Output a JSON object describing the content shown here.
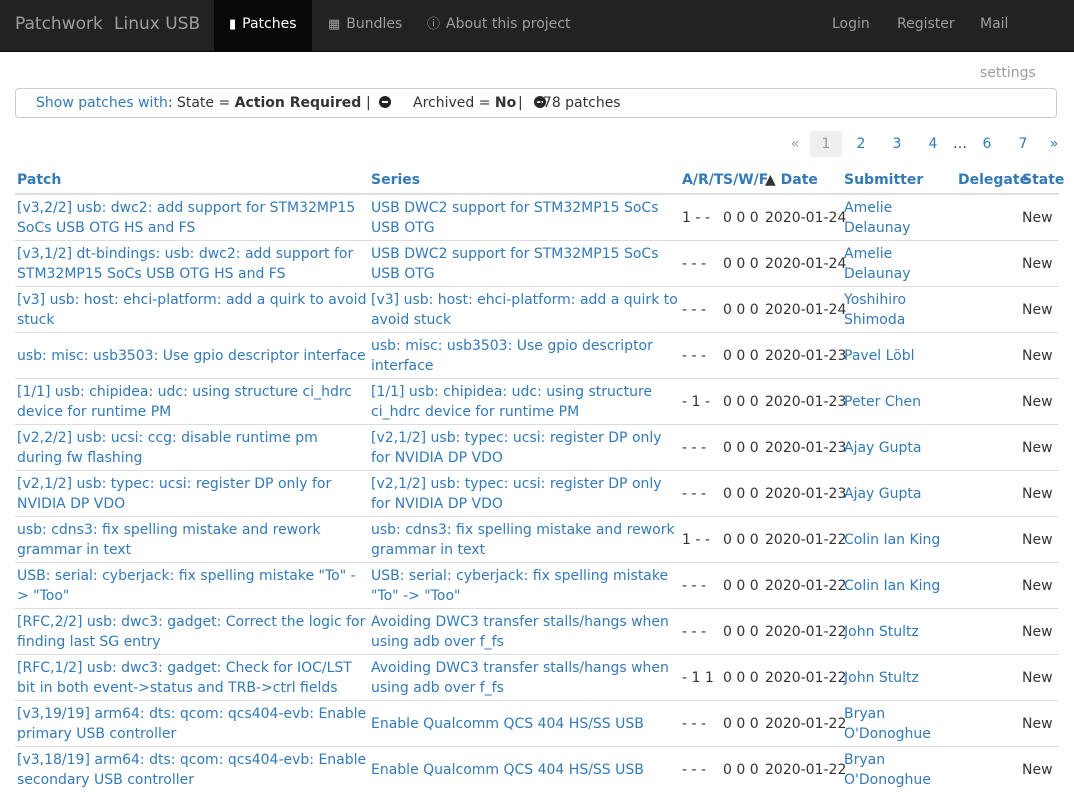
{
  "nav": {
    "brand": "Patchwork",
    "project": "Linux USB",
    "patches": "Patches",
    "bundles": "Bundles",
    "about": "About this project",
    "login": "Login",
    "register": "Register",
    "mail": "Mail settings"
  },
  "filter": {
    "show": "Show patches with",
    "state_label": ": State = ",
    "state_value": "Action Required",
    "sep1": "|",
    "archived_label": "Archived = ",
    "archived_value": "No",
    "sep2": "|",
    "count": "678 patches"
  },
  "pagination": {
    "prev": "«",
    "pages": [
      "1",
      "2",
      "3",
      "4"
    ],
    "ellipsis": "…",
    "pages2": [
      "6",
      "7"
    ],
    "next": "»"
  },
  "table": {
    "headers": {
      "patch": "Patch",
      "series": "Series",
      "art": "A/R/T",
      "swf": "S/W/F",
      "date": "Date",
      "submitter": "Submitter",
      "delegate": "Delegate",
      "state": "State"
    },
    "rows": [
      {
        "patch": "[v3,2/2] usb: dwc2: add support for STM32MP15 SoCs USB OTG HS and FS",
        "series": "USB DWC2 support for STM32MP15 SoCs USB OTG",
        "art": "1 - -",
        "swf": "0 0 0",
        "date": "2020-01-24",
        "submitter": "Amelie Delaunay",
        "delegate": "",
        "state": "New"
      },
      {
        "patch": "[v3,1/2] dt-bindings: usb: dwc2: add support for STM32MP15 SoCs USB OTG HS and FS",
        "series": "USB DWC2 support for STM32MP15 SoCs USB OTG",
        "art": "- - -",
        "swf": "0 0 0",
        "date": "2020-01-24",
        "submitter": "Amelie Delaunay",
        "delegate": "",
        "state": "New"
      },
      {
        "patch": "[v3] usb: host: ehci-platform: add a quirk to avoid stuck",
        "series": "[v3] usb: host: ehci-platform: add a quirk to avoid stuck",
        "art": "- - -",
        "swf": "0 0 0",
        "date": "2020-01-24",
        "submitter": "Yoshihiro Shimoda",
        "delegate": "",
        "state": "New"
      },
      {
        "patch": "usb: misc: usb3503: Use gpio descriptor interface",
        "series": "usb: misc: usb3503: Use gpio descriptor interface",
        "art": "- - -",
        "swf": "0 0 0",
        "date": "2020-01-23",
        "submitter": "Pavel Löbl",
        "delegate": "",
        "state": "New"
      },
      {
        "patch": "[1/1] usb: chipidea: udc: using structure ci_hdrc device for runtime PM",
        "series": "[1/1] usb: chipidea: udc: using structure ci_hdrc device for runtime PM",
        "art": "- 1 -",
        "swf": "0 0 0",
        "date": "2020-01-23",
        "submitter": "Peter Chen",
        "delegate": "",
        "state": "New"
      },
      {
        "patch": "[v2,2/2] usb: ucsi: ccg: disable runtime pm during fw flashing",
        "series": "[v2,1/2] usb: typec: ucsi: register DP only for NVIDIA DP VDO",
        "art": "- - -",
        "swf": "0 0 0",
        "date": "2020-01-23",
        "submitter": "Ajay Gupta",
        "delegate": "",
        "state": "New"
      },
      {
        "patch": "[v2,1/2] usb: typec: ucsi: register DP only for NVIDIA DP VDO",
        "series": "[v2,1/2] usb: typec: ucsi: register DP only for NVIDIA DP VDO",
        "art": "- - -",
        "swf": "0 0 0",
        "date": "2020-01-23",
        "submitter": "Ajay Gupta",
        "delegate": "",
        "state": "New"
      },
      {
        "patch": "usb: cdns3: fix spelling mistake and rework grammar in text",
        "series": "usb: cdns3: fix spelling mistake and rework grammar in text",
        "art": "1 - -",
        "swf": "0 0 0",
        "date": "2020-01-22",
        "submitter": "Colin Ian King",
        "delegate": "",
        "state": "New"
      },
      {
        "patch": "USB: serial: cyberjack: fix spelling mistake \"To\" -> \"Too\"",
        "series": "USB: serial: cyberjack: fix spelling mistake \"To\" -> \"Too\"",
        "art": "- - -",
        "swf": "0 0 0",
        "date": "2020-01-22",
        "submitter": "Colin Ian King",
        "delegate": "",
        "state": "New"
      },
      {
        "patch": "[RFC,2/2] usb: dwc3: gadget: Correct the logic for finding last SG entry",
        "series": "Avoiding DWC3 transfer stalls/hangs when using adb over f_fs",
        "art": "- - -",
        "swf": "0 0 0",
        "date": "2020-01-22",
        "submitter": "John Stultz",
        "delegate": "",
        "state": "New"
      },
      {
        "patch": "[RFC,1/2] usb: dwc3: gadget: Check for IOC/LST bit in both event->status and TRB->ctrl fields",
        "series": "Avoiding DWC3 transfer stalls/hangs when using adb over f_fs",
        "art": "- 1 1",
        "swf": "0 0 0",
        "date": "2020-01-22",
        "submitter": "John Stultz",
        "delegate": "",
        "state": "New"
      },
      {
        "patch": "[v3,19/19] arm64: dts: qcom: qcs404-evb: Enable primary USB controller",
        "series": "Enable Qualcomm QCS 404 HS/SS USB",
        "art": "- - -",
        "swf": "0 0 0",
        "date": "2020-01-22",
        "submitter": "Bryan O'Donoghue",
        "delegate": "",
        "state": "New"
      },
      {
        "patch": "[v3,18/19] arm64: dts: qcom: qcs404-evb: Enable secondary USB controller",
        "series": "Enable Qualcomm QCS 404 HS/SS USB",
        "art": "- - -",
        "swf": "0 0 0",
        "date": "2020-01-22",
        "submitter": "Bryan O'Donoghue",
        "delegate": "",
        "state": "New"
      }
    ]
  }
}
